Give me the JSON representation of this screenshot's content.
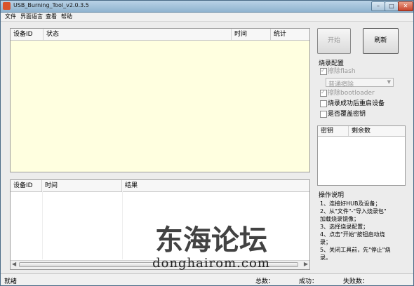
{
  "window": {
    "title": "USB_Burning_Tool_v2.0.3.5"
  },
  "caption": {
    "minimize": "–",
    "maximize": "□",
    "close": "✕"
  },
  "menu": [
    "文件",
    "界面语言",
    "查看",
    "帮助"
  ],
  "device_table": {
    "columns": [
      "设备ID",
      "状态",
      "时间",
      "统计"
    ]
  },
  "result_table": {
    "columns": [
      "设备ID",
      "时间",
      "结果"
    ]
  },
  "buttons": {
    "start": "开始",
    "refresh": "刷新"
  },
  "burn_config": {
    "title": "烧录配置",
    "erase_flash": "擦除flash",
    "erase_mode": "普通擦除",
    "erase_bootloader": "擦除bootloader",
    "reboot_after": "烧录成功后重启设备",
    "overwrite_key": "是否覆盖密钥"
  },
  "key_table": {
    "columns": [
      "密钥",
      "剩余数"
    ]
  },
  "instructions": {
    "title": "操作说明",
    "lines": [
      "1、连接好HUB及设备；",
      "2、从\"文件\"-\"导入烧录包\"",
      "加载烧录镜像；",
      "3、选择烧录配置；",
      "4、点击\"开始\"按钮启动烧",
      "录；",
      "5、关闭工具前，先\"停止\"烧",
      "录。"
    ]
  },
  "status": {
    "ready": "就绪",
    "total": "总数：",
    "success": "成功：",
    "fail": "失败数："
  },
  "watermark": {
    "cn": "东海论坛",
    "url": "donghairom.com"
  }
}
